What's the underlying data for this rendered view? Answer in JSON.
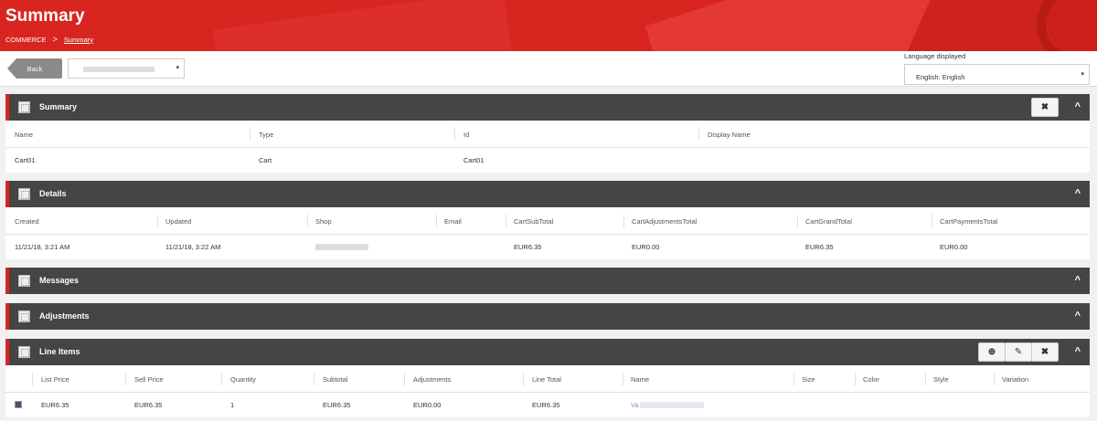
{
  "header": {
    "title": "Summary",
    "breadcrumb": [
      {
        "label": "COMMERCE"
      },
      {
        "label": "Summary"
      }
    ],
    "separator": ">"
  },
  "toolbar": {
    "back_label": "Back",
    "language_label": "Language displayed",
    "language_value": "English: English"
  },
  "summary": {
    "title": "Summary",
    "columns": [
      "Name",
      "Type",
      "Id",
      "Display Name"
    ],
    "values": [
      "Cart01",
      "Cart",
      "Cart01",
      ""
    ]
  },
  "details": {
    "title": "Details",
    "columns": [
      "Created",
      "Updated",
      "Shop",
      "Email",
      "CartSubTotal",
      "CartAdjustmentsTotal",
      "CartGrandTotal",
      "CartPaymentsTotal"
    ],
    "values": [
      "11/21/18, 3:21 AM",
      "11/21/18, 3:22 AM",
      "",
      "",
      "EUR6.35",
      "EUR0.00",
      "EUR6.35",
      "EUR0.00"
    ]
  },
  "messages": {
    "title": "Messages"
  },
  "adjustments": {
    "title": "Adjustments"
  },
  "line_items": {
    "title": "Line Items",
    "columns": [
      "List Price",
      "Sell Price",
      "Quantity",
      "Subtotal",
      "Adjustments",
      "Line Total",
      "Name",
      "Size",
      "Color",
      "Style",
      "Variation"
    ],
    "values": [
      "EUR6.35",
      "EUR6.35",
      "1",
      "EUR6.35",
      "EUR0.00",
      "EUR6.35",
      "Va",
      "",
      "",
      "",
      ""
    ]
  },
  "icons": {
    "close": "✖",
    "chevron": "^",
    "add": "⊕",
    "edit": "✎",
    "dropdown": "▾"
  }
}
